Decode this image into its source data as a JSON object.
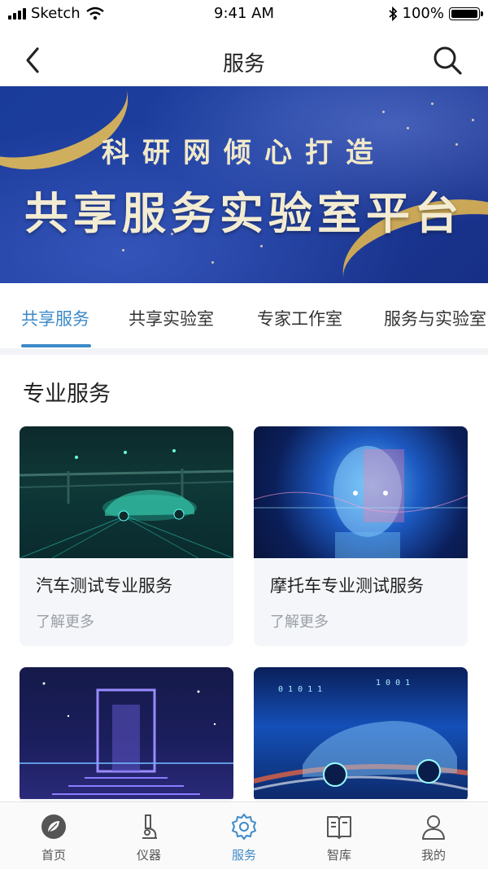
{
  "status_bar": {
    "carrier": "Sketch",
    "time": "9:41 AM",
    "battery": "100%"
  },
  "nav": {
    "title": "服务",
    "back_icon": "chevron-left-icon",
    "search_icon": "search-icon"
  },
  "banner": {
    "subtitle": "科研网倾心打造",
    "title": "共享服务实验室平台"
  },
  "tabs": [
    {
      "label": "共享服务",
      "active": true
    },
    {
      "label": "共享实验室",
      "active": false
    },
    {
      "label": "专家工作室",
      "active": false
    },
    {
      "label": "服务与实验室",
      "active": false
    }
  ],
  "section": {
    "title": "专业服务"
  },
  "cards": [
    {
      "title": "汽车测试专业服务",
      "more": "了解更多"
    },
    {
      "title": "摩托车专业测试服务",
      "more": "了解更多"
    },
    {
      "title": "",
      "more": ""
    },
    {
      "title": "",
      "more": ""
    }
  ],
  "bottom_nav": [
    {
      "label": "首页",
      "icon": "home-leaf-icon",
      "active": false
    },
    {
      "label": "仪器",
      "icon": "microscope-icon",
      "active": false
    },
    {
      "label": "服务",
      "icon": "gear-icon",
      "active": true
    },
    {
      "label": "智库",
      "icon": "book-icon",
      "active": false
    },
    {
      "label": "我的",
      "icon": "user-icon",
      "active": false
    }
  ],
  "colors": {
    "accent": "#3c8ac9",
    "banner_bg": "#1e3f9e",
    "card_bg": "#f4f6f9"
  }
}
